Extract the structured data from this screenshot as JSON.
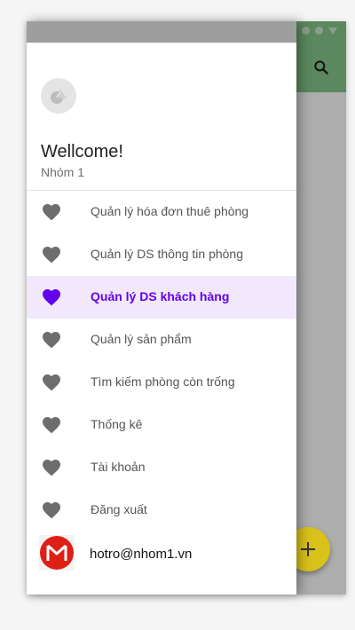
{
  "app": {
    "search_icon": "search-icon",
    "fab_icon": "plus-icon"
  },
  "drawer": {
    "header": {
      "avatar_icon": "app-logo-icon",
      "title": "Wellcome!",
      "subtitle": "Nhóm 1"
    },
    "items": [
      {
        "label": "Quản lý hóa đơn thuê phòng",
        "icon": "heart-icon",
        "active": false
      },
      {
        "label": "Quản lý DS thông tin phòng",
        "icon": "heart-icon",
        "active": false
      },
      {
        "label": "Quản lý DS khách hàng",
        "icon": "heart-icon",
        "active": true
      },
      {
        "label": "Quản lý sản phẩm",
        "icon": "heart-icon",
        "active": false
      },
      {
        "label": "Tìm kiếm phòng còn trống",
        "icon": "heart-icon",
        "active": false
      },
      {
        "label": "Thống kê",
        "icon": "heart-icon",
        "active": false
      },
      {
        "label": "Tài khoản",
        "icon": "heart-icon",
        "active": false
      },
      {
        "label": "Đăng xuất",
        "icon": "heart-icon",
        "active": false
      }
    ],
    "footer": {
      "logo_icon": "gmail-icon",
      "email": "hotro@nhom1.vn"
    }
  },
  "colors": {
    "app_bar": "#86c98b",
    "accent": "#6200ee",
    "active_bg": "#f1e9fb",
    "fab": "#d9c21a"
  }
}
